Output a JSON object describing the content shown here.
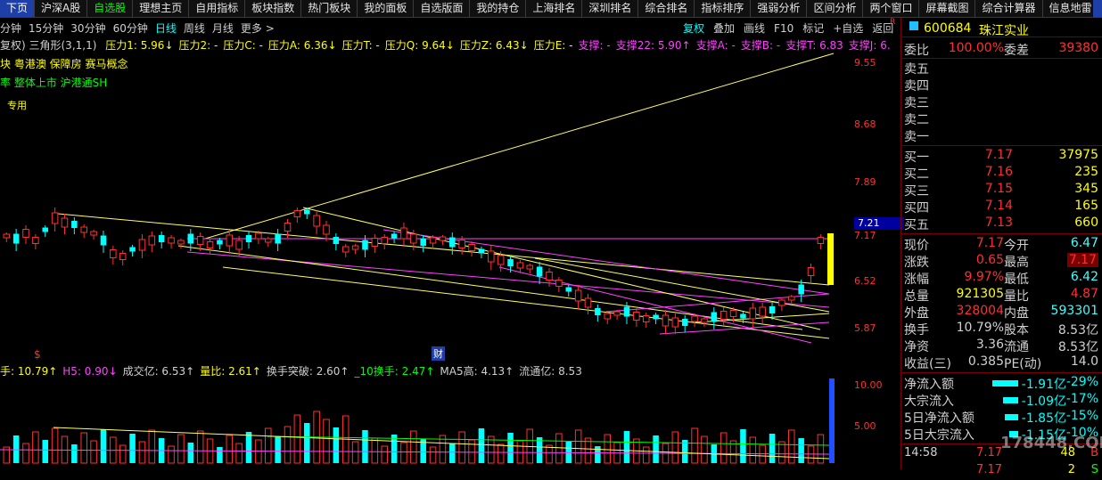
{
  "nav": {
    "tabs": [
      "下页",
      "沪深A股",
      "自选股",
      "理想主页",
      "自用指标",
      "板块指数",
      "热门板块",
      "我的面板",
      "自选版面",
      "我的持仓",
      "上海排名",
      "深圳排名",
      "综合排名",
      "指标排序",
      "强弱分析",
      "区间分析",
      "两个窗口",
      "屏幕截图",
      "综合计算器",
      "信息地雷"
    ],
    "active_index": 2
  },
  "indicator_line": {
    "prefix": "复权) 三角形(3,1,1)",
    "items": [
      {
        "text": "压力1: 5.96↓",
        "color": "yellow"
      },
      {
        "text": "压力2: -",
        "color": "yellow"
      },
      {
        "text": "压力C: -",
        "color": "yellow"
      },
      {
        "text": "压力A: 6.36↓",
        "color": "yellow"
      },
      {
        "text": "压力T: -",
        "color": "yellow"
      },
      {
        "text": "压力Q: 9.64↓",
        "color": "yellow"
      },
      {
        "text": "压力Z: 6.43↓",
        "color": "yellow"
      },
      {
        "text": "压力E: -",
        "color": "yellow"
      },
      {
        "text": "支撑: -",
        "color": "magenta"
      },
      {
        "text": "支撑22: 5.90↑",
        "color": "magenta"
      },
      {
        "text": "支撑A: -",
        "color": "magenta"
      },
      {
        "text": "支撑B: -",
        "color": "magenta"
      },
      {
        "text": "支撑T: 6.83",
        "color": "magenta"
      },
      {
        "text": "支撑J: 6.",
        "color": "magenta"
      }
    ]
  },
  "concepts_line": "块 粤港澳 保障房 赛马概念",
  "concepts_line2": "率 整体上市 沪港通SH",
  "special_label": "专用",
  "periods": {
    "items": [
      "分钟",
      "15分钟",
      "30分钟",
      "60分钟",
      "日线",
      "周线",
      "月线",
      "更多 >"
    ],
    "selected": "日线"
  },
  "tools": {
    "items": [
      "复权",
      "叠加",
      "画线",
      "F10",
      "标记",
      "+自选",
      "返回"
    ],
    "selected": "复权"
  },
  "price_axis": [
    "9.55",
    "8.68",
    "7.89",
    "7.17",
    "6.52",
    "5.87"
  ],
  "current_price_tag": "7.21",
  "marks": {
    "s": "$",
    "cai": "财"
  },
  "volume_indicators": [
    {
      "text": "手: 10.79↑",
      "color": "yellow"
    },
    {
      "text": "H5: 0.90↓",
      "color": "magenta"
    },
    {
      "text": "成交亿: 6.53↑",
      "color": "white"
    },
    {
      "text": "量比: 2.61↑",
      "color": "yellow"
    },
    {
      "text": "换手突破: 2.60↑",
      "color": "white"
    },
    {
      "text": "_10换手: 2.47↑",
      "color": "green"
    },
    {
      "text": "MA5高: 4.13↑",
      "color": "white"
    },
    {
      "text": "流通亿: 8.53",
      "color": "white"
    }
  ],
  "volume_axis": [
    "10.00",
    "5.00"
  ],
  "stock": {
    "flag": "R",
    "code": "600684",
    "name": "珠江实业"
  },
  "order_ratio": {
    "label": "委比",
    "value": "100.00%",
    "label2": "委差",
    "value2": "39380"
  },
  "sell_levels": [
    "卖五",
    "卖四",
    "卖三",
    "卖二",
    "卖一"
  ],
  "buy_levels": [
    {
      "label": "买一",
      "price": "7.17",
      "vol": "37975"
    },
    {
      "label": "买二",
      "price": "7.16",
      "vol": "235"
    },
    {
      "label": "买三",
      "price": "7.15",
      "vol": "345"
    },
    {
      "label": "买四",
      "price": "7.14",
      "vol": "165"
    },
    {
      "label": "买五",
      "price": "7.13",
      "vol": "660"
    }
  ],
  "quote": [
    {
      "l1": "现价",
      "v1": "7.17",
      "c1": "red",
      "l2": "今开",
      "v2": "6.47",
      "c2": "cyan"
    },
    {
      "l1": "涨跌",
      "v1": "0.65",
      "c1": "red",
      "l2": "最高",
      "v2": "7.17",
      "c2": "red",
      "box2": true
    },
    {
      "l1": "涨幅",
      "v1": "9.97%",
      "c1": "red",
      "l2": "最低",
      "v2": "6.42",
      "c2": "cyan"
    },
    {
      "l1": "总量",
      "v1": "921305",
      "c1": "yellow",
      "l2": "量比",
      "v2": "4.87",
      "c2": "red"
    },
    {
      "l1": "外盘",
      "v1": "328004",
      "c1": "red",
      "l2": "内盘",
      "v2": "593301",
      "c2": "cyan"
    },
    {
      "l1": "换手",
      "v1": "10.79%",
      "c1": "white",
      "l2": "股本",
      "v2": "8.53亿",
      "c2": "white"
    },
    {
      "l1": "净资",
      "v1": "3.36",
      "c1": "white",
      "l2": "流通",
      "v2": "8.53亿",
      "c2": "white"
    },
    {
      "l1": "收益(三)",
      "v1": "0.385",
      "c1": "white",
      "l2": "PE(动)",
      "v2": "14.0",
      "c2": "white"
    }
  ],
  "fund_flow": [
    {
      "label": "净流入额",
      "value": "-1.91亿",
      "pct": "-29%",
      "bar": 0.29
    },
    {
      "label": "大宗流入",
      "value": "-1.09亿",
      "pct": "-17%",
      "bar": 0.17
    },
    {
      "label": "5日净流入额",
      "value": "-1.85亿",
      "pct": "-15%",
      "bar": 0.15
    },
    {
      "label": "5日大宗流入",
      "value": "-1.15亿",
      "pct": "-10%",
      "bar": 0.1
    }
  ],
  "ticks": [
    {
      "time": "14:58",
      "price": "7.17",
      "vol": "48",
      "dir": "B"
    },
    {
      "time": "",
      "price": "7.17",
      "vol": "2",
      "dir": "S"
    }
  ],
  "watermark": "178448.COM"
}
